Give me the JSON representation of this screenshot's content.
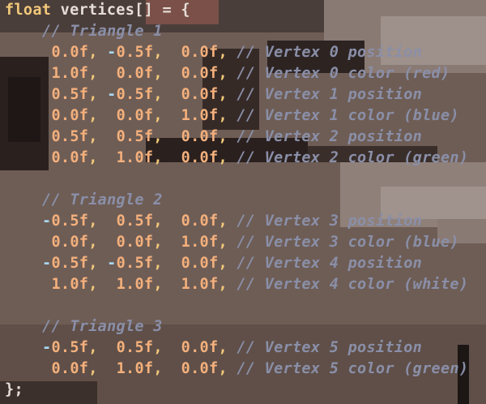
{
  "colors": {
    "background": "#6b5a52",
    "keyword": "#f2c97a",
    "number": "#f4b07c",
    "minus": "#a9d7f0",
    "comment": "#8a8fa8",
    "text": "#e6ded8"
  },
  "code": {
    "decl_keyword": "float",
    "decl_rest": "vertices[] = {",
    "close": "};",
    "groups": [
      {
        "comment": "// Triangle 1",
        "rows": [
          {
            "values": [
              "0.0f",
              "-0.5f",
              "0.0f"
            ],
            "comment": "// Vertex 0 position"
          },
          {
            "values": [
              "1.0f",
              "0.0f",
              "0.0f"
            ],
            "comment": "// Vertex 0 color (red)"
          },
          {
            "values": [
              "0.5f",
              "-0.5f",
              "0.0f"
            ],
            "comment": "// Vertex 1 position"
          },
          {
            "values": [
              "0.0f",
              "0.0f",
              "1.0f"
            ],
            "comment": "// Vertex 1 color (blue)"
          },
          {
            "values": [
              "0.5f",
              "0.5f",
              "0.0f"
            ],
            "comment": "// Vertex 2 position"
          },
          {
            "values": [
              "0.0f",
              "1.0f",
              "0.0f"
            ],
            "comment": "// Vertex 2 color (green)"
          }
        ]
      },
      {
        "comment": "// Triangle 2",
        "rows": [
          {
            "values": [
              "-0.5f",
              "0.5f",
              "0.0f"
            ],
            "comment": "// Vertex 3 position"
          },
          {
            "values": [
              "0.0f",
              "0.0f",
              "1.0f"
            ],
            "comment": "// Vertex 3 color (blue)"
          },
          {
            "values": [
              "-0.5f",
              "-0.5f",
              "0.0f"
            ],
            "comment": "// Vertex 4 position"
          },
          {
            "values": [
              "1.0f",
              "1.0f",
              "1.0f"
            ],
            "comment": "// Vertex 4 color (white)"
          }
        ]
      },
      {
        "comment": "// Triangle 3",
        "rows": [
          {
            "values": [
              "-0.5f",
              "0.5f",
              "0.0f"
            ],
            "comment": "// Vertex 5 position"
          },
          {
            "values": [
              "0.0f",
              "1.0f",
              "0.0f"
            ],
            "comment": "// Vertex 5 color (green)"
          }
        ]
      }
    ]
  }
}
